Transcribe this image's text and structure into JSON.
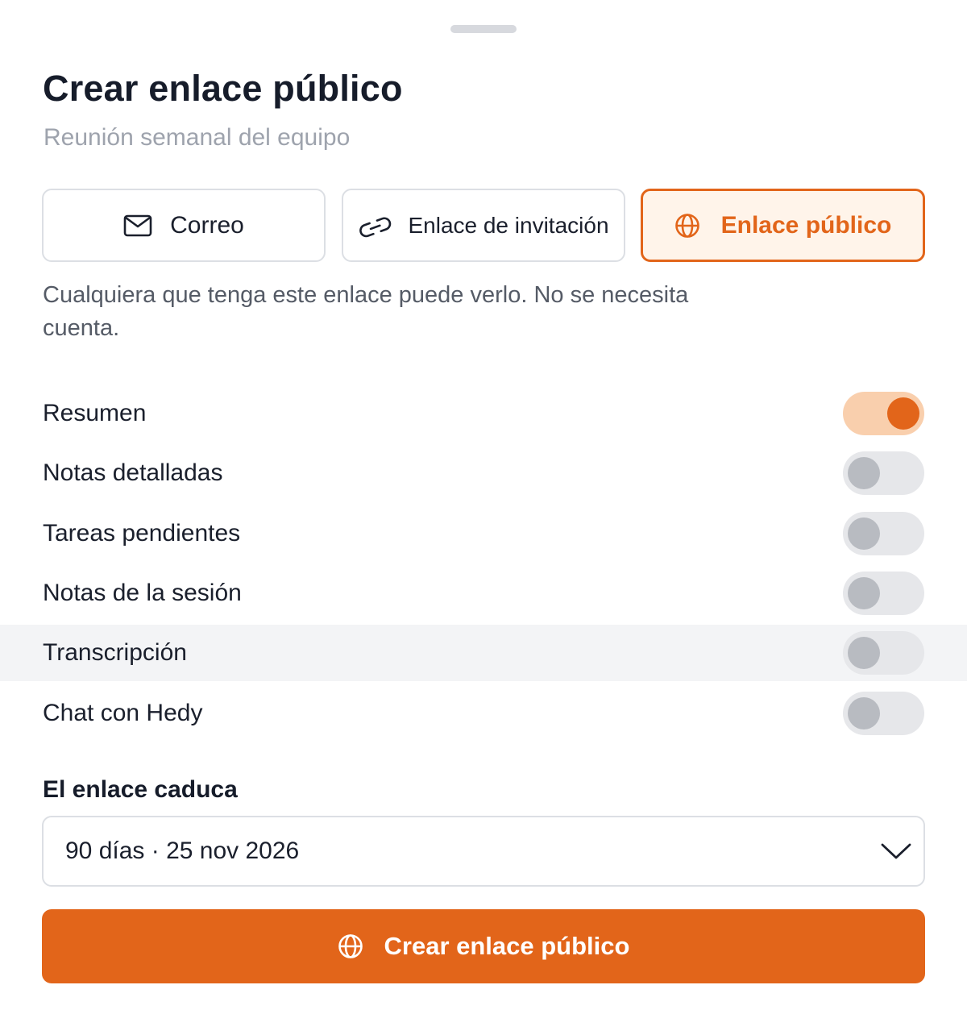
{
  "header": {
    "title": "Crear enlace público",
    "subtitle": "Reunión semanal del equipo"
  },
  "tabs": [
    {
      "label": "Correo",
      "icon": "mail-icon",
      "selected": false
    },
    {
      "label": "Enlace de invitación",
      "icon": "link-icon",
      "selected": false
    },
    {
      "label": "Enlace público",
      "icon": "globe-icon",
      "selected": true
    }
  ],
  "description": "Cualquiera que tenga este enlace puede verlo. No se necesita cuenta.",
  "options": [
    {
      "label": "Resumen",
      "enabled": true
    },
    {
      "label": "Notas detalladas",
      "enabled": false
    },
    {
      "label": "Tareas pendientes",
      "enabled": false
    },
    {
      "label": "Notas de la sesión",
      "enabled": false
    },
    {
      "label": "Transcripción",
      "enabled": false
    },
    {
      "label": "Chat con Hedy",
      "enabled": false
    }
  ],
  "expiry": {
    "label": "El enlace caduca",
    "value": "90 días · 25 nov 2026"
  },
  "cta": {
    "label": "Crear enlace público",
    "icon": "globe-icon"
  },
  "colors": {
    "accent": "#e2651a",
    "accent_light": "#fff4ea",
    "toggle_on_track": "#f9cfad",
    "toggle_off_track": "#e6e7ea",
    "toggle_off_knob": "#b8bbc1"
  }
}
